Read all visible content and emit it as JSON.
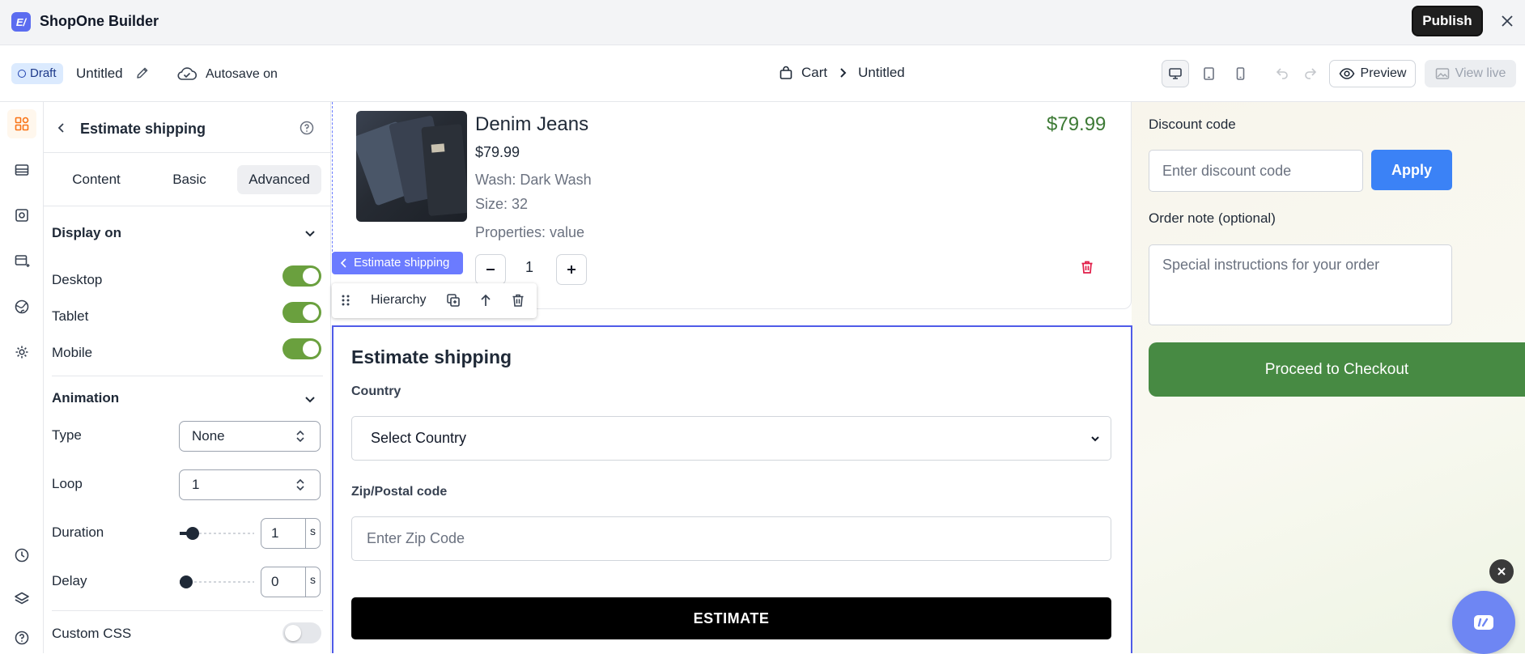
{
  "app": {
    "title": "ShopOne Builder",
    "publish_label": "Publish"
  },
  "doc": {
    "status": "Draft",
    "name": "Untitled",
    "autosave": "Autosave on"
  },
  "breadcrumb": {
    "page": "Cart",
    "current": "Untitled"
  },
  "toolbar": {
    "preview_label": "Preview",
    "view_live_label": "View live"
  },
  "panel": {
    "title": "Estimate shipping",
    "tabs": [
      {
        "label": "Content"
      },
      {
        "label": "Basic"
      },
      {
        "label": "Advanced"
      }
    ],
    "active_tab": "Advanced",
    "display_on": {
      "title": "Display on",
      "items": [
        {
          "label": "Desktop",
          "enabled": true
        },
        {
          "label": "Tablet",
          "enabled": true
        },
        {
          "label": "Mobile",
          "enabled": true
        }
      ]
    },
    "animation": {
      "title": "Animation",
      "type_label": "Type",
      "type_value": "None",
      "loop_label": "Loop",
      "loop_value": "1",
      "duration_label": "Duration",
      "duration_value": "1",
      "duration_unit": "s",
      "duration_level": 0.1,
      "delay_label": "Delay",
      "delay_value": "0",
      "delay_unit": "s",
      "delay_level": 0
    },
    "custom_css": {
      "label": "Custom CSS",
      "enabled": false
    }
  },
  "product": {
    "name": "Denim Jeans",
    "price": "$79.99",
    "options": [
      "Wash: Dark Wash",
      "Size: 32",
      "Properties: value"
    ],
    "quantity": "1",
    "line_total": "$79.99"
  },
  "element_toolbar": {
    "label": "Estimate shipping",
    "hierarchy": "Hierarchy"
  },
  "estimate": {
    "title": "Estimate shipping",
    "country_label": "Country",
    "country_value": "Select Country",
    "zip_label": "Zip/Postal code",
    "zip_placeholder": "Enter Zip Code",
    "button": "ESTIMATE"
  },
  "summary": {
    "discount_label": "Discount code",
    "discount_placeholder": "Enter discount code",
    "apply": "Apply",
    "note_label": "Order note (optional)",
    "note_placeholder": "Special instructions for your order",
    "checkout": "Proceed to Checkout"
  },
  "colors": {
    "accent": "#5b6cf0",
    "toggle_on": "#6aa03e",
    "checkout": "#478a43",
    "apply": "#3b82f6",
    "price": "#3d7a35",
    "delete": "#e11d48"
  }
}
